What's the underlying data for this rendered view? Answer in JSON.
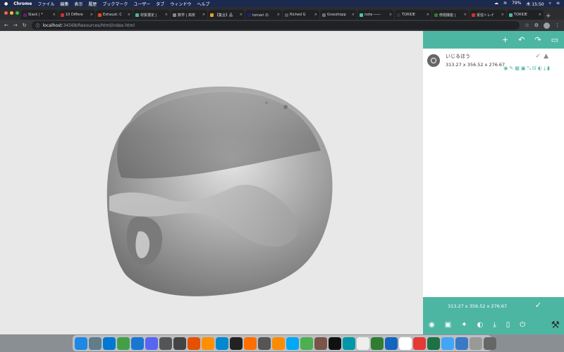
{
  "menubar": {
    "apple": "",
    "app": "Chrome",
    "items": [
      "ファイル",
      "編集",
      "表示",
      "履歴",
      "ブックマーク",
      "ユーザー",
      "タブ",
      "ウィンドウ",
      "ヘルプ"
    ],
    "battery": "79%",
    "clock": "木 15:50"
  },
  "tabs": [
    {
      "title": "Slack | * ",
      "color": "#611f69"
    },
    {
      "title": "10 Differe",
      "color": "#d32f2f"
    },
    {
      "title": "Exhaust: C",
      "color": "#e64a19"
    },
    {
      "title": "材質選定 |",
      "color": "#4db6a3"
    },
    {
      "title": "数学 | 高校",
      "color": "#888888"
    },
    {
      "title": "【集合】品",
      "color": "#e0a030"
    },
    {
      "title": "tomari の",
      "color": "#1a237e"
    },
    {
      "title": "Riched G",
      "color": "#555555"
    },
    {
      "title": "Grasshopp",
      "color": "#6d6d6d"
    },
    {
      "title": "note ――",
      "color": "#41c9b4"
    },
    {
      "title": "TORIDE",
      "color": "#333333"
    },
    {
      "title": "修繕機能 |",
      "color": "#2e7d32"
    },
    {
      "title": "受信トレイ",
      "color": "#d93025"
    },
    {
      "title": "TORIDE",
      "color": "#4db6a3"
    }
  ],
  "address": {
    "host": "localhost",
    "path": ":34568/Resources/html/index.html"
  },
  "panel": {
    "item_name": "いじるほう",
    "item_dims": "313.27 x 356.52 x 276.67",
    "bottom_dims": "313.27 x 356.52 x 276.67"
  },
  "colors": {
    "accent": "#4db6a3"
  },
  "dock_colors": [
    "#1e88e5",
    "#607d8b",
    "#0078d4",
    "#43a047",
    "#1976d2",
    "#5865f2",
    "#555555",
    "#444444",
    "#e65100",
    "#ff8f00",
    "#0288d1",
    "#222222",
    "#ff6f00",
    "#555555",
    "#fb8c00",
    "#03a9f4",
    "#4caf50",
    "#795548",
    "#111111",
    "#0097a7",
    "#eeeeee",
    "#2e7d32",
    "#1565c0",
    "#ffffff",
    "#e53935",
    "#1e7145",
    "#42a5f5",
    "#3a79c4",
    "#999999",
    "#666666"
  ]
}
